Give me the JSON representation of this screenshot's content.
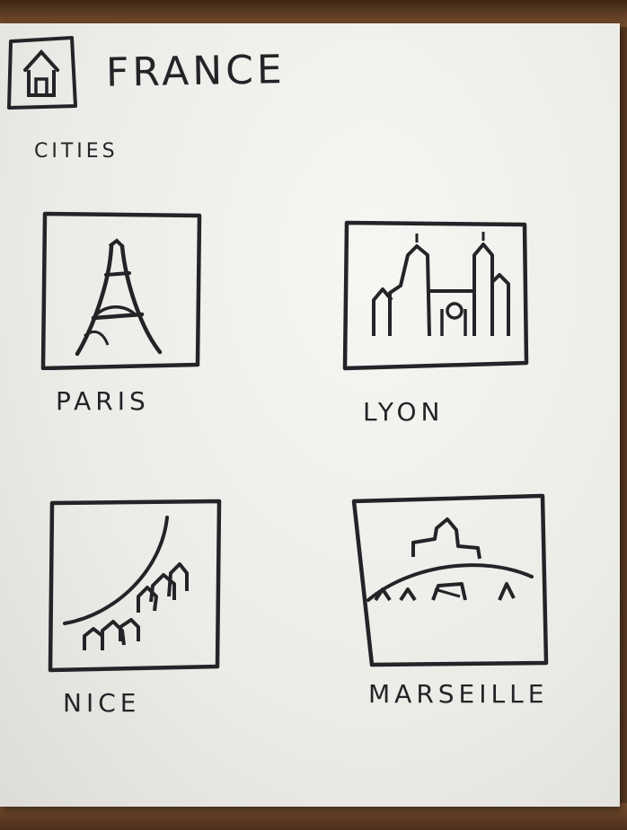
{
  "header": {
    "title": "FRANCE",
    "home_icon": "home-icon"
  },
  "section": {
    "heading": "CITIES"
  },
  "cities": [
    {
      "label": "PARIS",
      "icon": "eiffel-tower-icon"
    },
    {
      "label": "LYON",
      "icon": "cathedral-icon"
    },
    {
      "label": "NICE",
      "icon": "coastline-houses-icon"
    },
    {
      "label": "MARSEILLE",
      "icon": "hilltop-basilica-icon"
    }
  ]
}
